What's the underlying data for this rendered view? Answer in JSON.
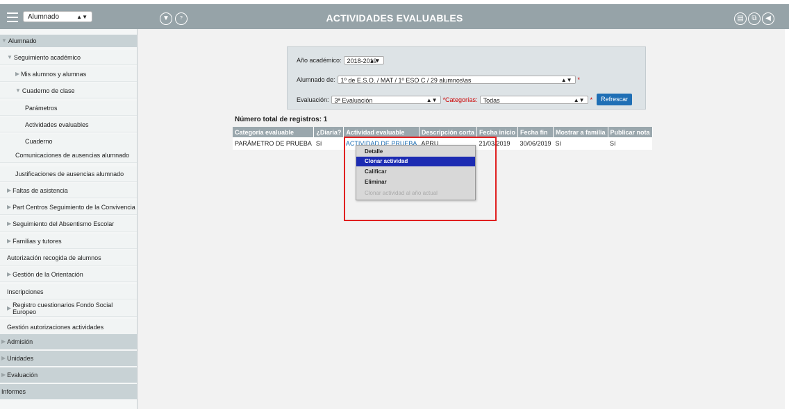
{
  "header": {
    "title": "ACTIVIDADES EVALUABLES",
    "profile": "Alumnado",
    "icons": [
      "filter-icon",
      "help-icon",
      "print-icon",
      "copy-icon",
      "back-icon"
    ]
  },
  "sidebar": {
    "items": [
      {
        "label": "Alumnado",
        "level": 0,
        "open": true
      },
      {
        "label": "Seguimiento académico",
        "level": 1,
        "open": true
      },
      {
        "label": "Mis alumnos y alumnas",
        "level": 2,
        "open": false
      },
      {
        "label": "Cuaderno de clase",
        "level": 2,
        "open": true
      },
      {
        "label": "Parámetros",
        "level": 3
      },
      {
        "label": "Actividades evaluables",
        "level": 3
      },
      {
        "label": "Cuaderno",
        "level": 3
      },
      {
        "label": "Comunicaciones de ausencias alumnado",
        "level": 2
      },
      {
        "label": "Justificaciones de ausencias alumnado",
        "level": 2
      },
      {
        "label": "Faltas de asistencia",
        "level": 1,
        "open": false
      },
      {
        "label": "Part Centros Seguimiento de la Convivencia",
        "level": 1,
        "open": false
      },
      {
        "label": "Seguimiento del Absentismo Escolar",
        "level": 1,
        "open": false
      },
      {
        "label": "Familias y tutores",
        "level": 1,
        "open": false
      },
      {
        "label": "Autorización recogida de alumnos",
        "level": 1
      },
      {
        "label": "Gestión de la Orientación",
        "level": 1,
        "open": false
      },
      {
        "label": "Inscripciones",
        "level": 1
      },
      {
        "label": "Registro cuestionarios Fondo Social Europeo",
        "level": 1,
        "open": false
      },
      {
        "label": "Gestión autorizaciones actividades",
        "level": 1
      },
      {
        "label": "Admisión",
        "level": 0,
        "open": false
      },
      {
        "label": "Unidades",
        "level": 0,
        "open": false
      },
      {
        "label": "Evaluación",
        "level": 0,
        "open": false
      },
      {
        "label": "Informes",
        "level": 0
      }
    ]
  },
  "filters": {
    "anio_label": "Año académico:",
    "anio_value": "2018-2019",
    "alumnado_label": "Alumnado de:",
    "alumnado_value": "1º de E.S.O. / MAT / 1º ESO C / 29 alumnos\\as",
    "evaluacion_label": "Evaluación:",
    "evaluacion_value": "3ª Evaluación",
    "categorias_label": "*Categorías:",
    "categorias_value": "Todas",
    "required_mark": "*",
    "refresh_button": "Refrescar"
  },
  "records": {
    "total_label": "Número total de registros: 1"
  },
  "table": {
    "headers": [
      "Categoría evaluable",
      "¿Diaria?",
      "Actividad evaluable",
      "Descripción corta",
      "Fecha inicio",
      "Fecha fin",
      "Mostrar a familia",
      "Publicar nota"
    ],
    "rows": [
      [
        "PARÁMETRO DE PRUEBA",
        "Sí",
        "ACTIVIDAD DE PRUEBA",
        "APRU",
        "21/03/2019",
        "30/06/2019",
        "Sí",
        "Sí"
      ]
    ]
  },
  "context_menu": {
    "items": [
      {
        "label": "Detalle",
        "state": "normal"
      },
      {
        "label": "Clonar actividad",
        "state": "highlighted"
      },
      {
        "label": "Calificar",
        "state": "normal"
      },
      {
        "label": "Eliminar",
        "state": "normal"
      },
      {
        "label": "Clonar actividad al año actual",
        "state": "disabled"
      }
    ]
  },
  "colors": {
    "header_bg": "#96a3a8",
    "table_header_bg": "#9aa7ad",
    "highlight": "#1c2bb2",
    "refresh_button": "#1f6fb5",
    "annotation_box": "#e02020"
  }
}
